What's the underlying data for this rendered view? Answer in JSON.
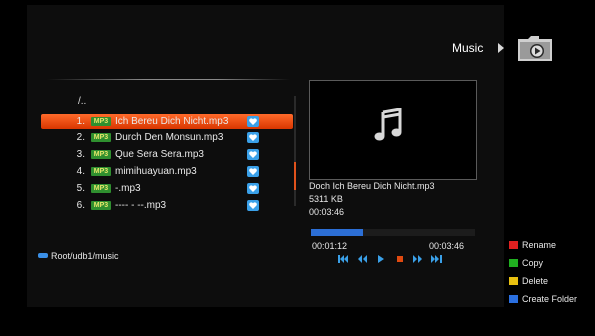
{
  "header": {
    "title": "Music"
  },
  "browser": {
    "parent_dir": "/..",
    "path": "Root/udb1/music",
    "files": [
      {
        "num": "1.",
        "type": "MP3",
        "name": "Ich Bereu  Dich Nicht.mp3",
        "selected": true
      },
      {
        "num": "2.",
        "type": "MP3",
        "name": "Durch Den Monsun.mp3",
        "selected": false
      },
      {
        "num": "3.",
        "type": "MP3",
        "name": "Que Sera Sera.mp3",
        "selected": false
      },
      {
        "num": "4.",
        "type": "MP3",
        "name": "mimihuayuan.mp3",
        "selected": false
      },
      {
        "num": "5.",
        "type": "MP3",
        "name": "-.mp3",
        "selected": false
      },
      {
        "num": "6.",
        "type": "MP3",
        "name": "---- - --.mp3",
        "selected": false
      }
    ]
  },
  "preview": {
    "title": "Doch Ich Bereu  Dich Nicht.mp3",
    "size": "5311 KB",
    "duration": "00:03:46"
  },
  "playback": {
    "elapsed": "00:01:12",
    "total": "00:03:46",
    "progress_fraction": 0.32,
    "controls": [
      "skip-back-icon",
      "rewind-icon",
      "play-icon",
      "stop-icon",
      "fast-forward-icon",
      "skip-forward-icon"
    ]
  },
  "legend": [
    {
      "label": "Rename",
      "color": "#e02020"
    },
    {
      "label": "Copy",
      "color": "#20b020"
    },
    {
      "label": "Delete",
      "color": "#e8c010"
    },
    {
      "label": "Create Folder",
      "color": "#2a6fe0"
    }
  ],
  "colors": {
    "selection": "#e04a10",
    "accent_blue": "#2c6fd6"
  }
}
